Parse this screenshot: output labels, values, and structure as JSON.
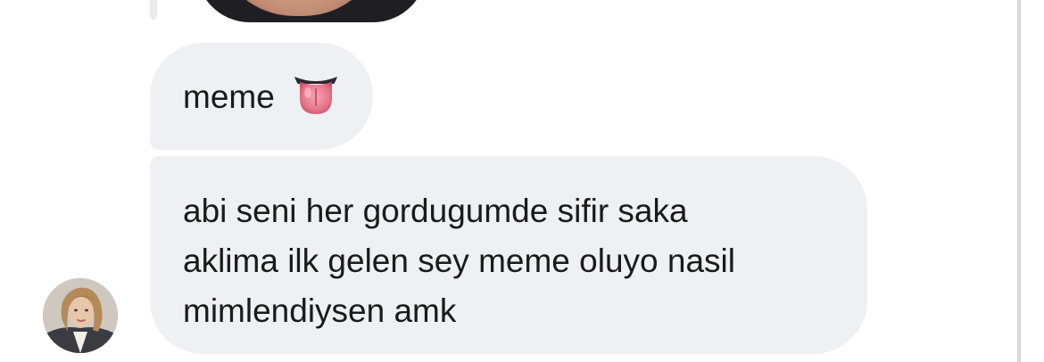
{
  "messages": [
    {
      "text": "meme",
      "emoji": "tongue-emoji"
    },
    {
      "lines": [
        "abi seni her gordugumde sifir saka",
        "aklima ilk gelen sey meme oluyo nasil",
        "mimlendiysen amk"
      ]
    }
  ],
  "colors": {
    "bubble": "#eef0f3",
    "text": "#1a1a1c",
    "background": "#ffffff"
  }
}
